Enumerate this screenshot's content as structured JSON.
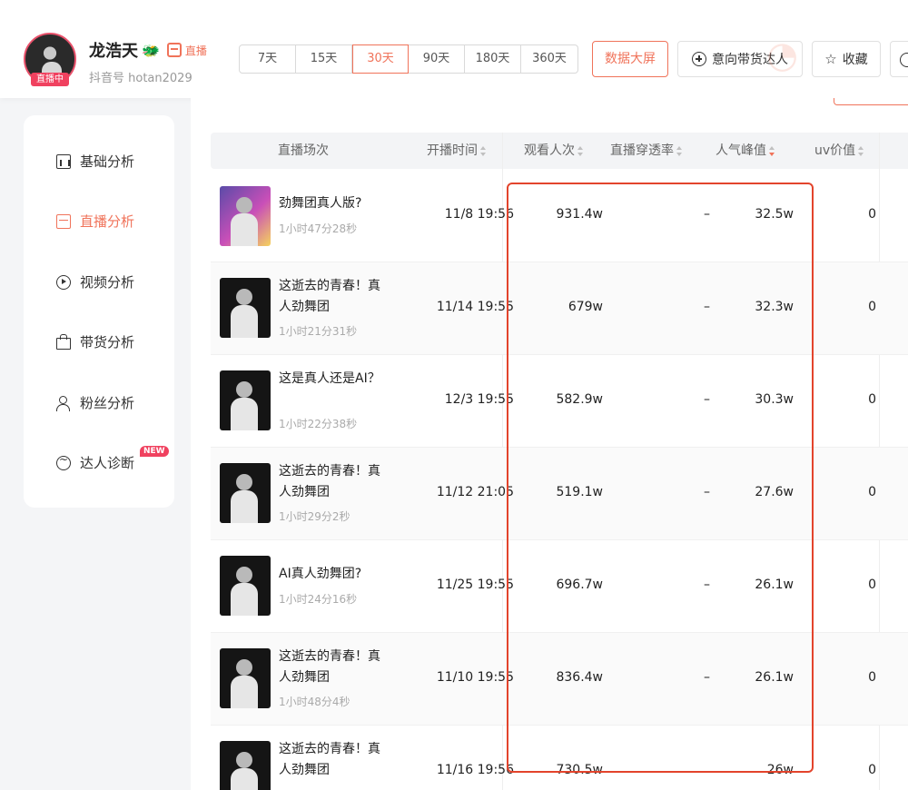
{
  "header": {
    "user_name": "龙浩天",
    "live_badge": "直播中",
    "live_tag": "直播",
    "douyin_id": "抖音号 hotan2029",
    "ranges": [
      "7天",
      "15天",
      "30天",
      "90天",
      "180天",
      "360天"
    ],
    "active_range": "30天",
    "screen_button": "数据大屏",
    "intent_button": "意向带货达人",
    "fav_button": "收藏"
  },
  "sidebar": {
    "items": [
      {
        "label": "基础分析",
        "icon": "bar-chart-icon"
      },
      {
        "label": "直播分析",
        "icon": "live-icon"
      },
      {
        "label": "视频分析",
        "icon": "play-icon"
      },
      {
        "label": "带货分析",
        "icon": "bag-icon"
      },
      {
        "label": "粉丝分析",
        "icon": "user-icon"
      },
      {
        "label": "达人诊断",
        "icon": "pulse-icon"
      }
    ],
    "active": "直播分析",
    "new_badge": "NEW"
  },
  "table": {
    "columns": [
      "直播场次",
      "开播时间",
      "观看人次",
      "直播穿透率",
      "人气峰值",
      "uv价值"
    ],
    "sorted_column": "人气峰值",
    "rows": [
      {
        "title": "劲舞团真人版?",
        "duration": "1小时47分28秒",
        "time": "11/8 19:56",
        "views": "931.4w",
        "penetration": "–",
        "peak": "32.5w",
        "uv": "0"
      },
      {
        "title": "这逝去的青春！真人劲舞团",
        "duration": "1小时21分31秒",
        "time": "11/14 19:55",
        "views": "679w",
        "penetration": "–",
        "peak": "32.3w",
        "uv": "0"
      },
      {
        "title": "这是真人还是AI？",
        "duration": "1小时22分38秒",
        "time": "12/3 19:55",
        "views": "582.9w",
        "penetration": "–",
        "peak": "30.3w",
        "uv": "0"
      },
      {
        "title": "这逝去的青春！真人劲舞团",
        "duration": "1小时29分2秒",
        "time": "11/12 21:05",
        "views": "519.1w",
        "penetration": "–",
        "peak": "27.6w",
        "uv": "0"
      },
      {
        "title": "AI真人劲舞团?",
        "duration": "1小时24分16秒",
        "time": "11/25 19:55",
        "views": "696.7w",
        "penetration": "–",
        "peak": "26.1w",
        "uv": "0"
      },
      {
        "title": "这逝去的青春！真人劲舞团",
        "duration": "1小时48分4秒",
        "time": "11/10 19:55",
        "views": "836.4w",
        "penetration": "–",
        "peak": "26.1w",
        "uv": "0"
      },
      {
        "title": "这逝去的青春！真人劲舞团",
        "duration": "",
        "time": "11/16 19:56",
        "views": "730.5w",
        "penetration": "",
        "peak": "26w",
        "uv": "0"
      }
    ]
  },
  "colors": {
    "accent": "#f0735a",
    "highlight": "#e3442c",
    "live": "#f0415f"
  }
}
